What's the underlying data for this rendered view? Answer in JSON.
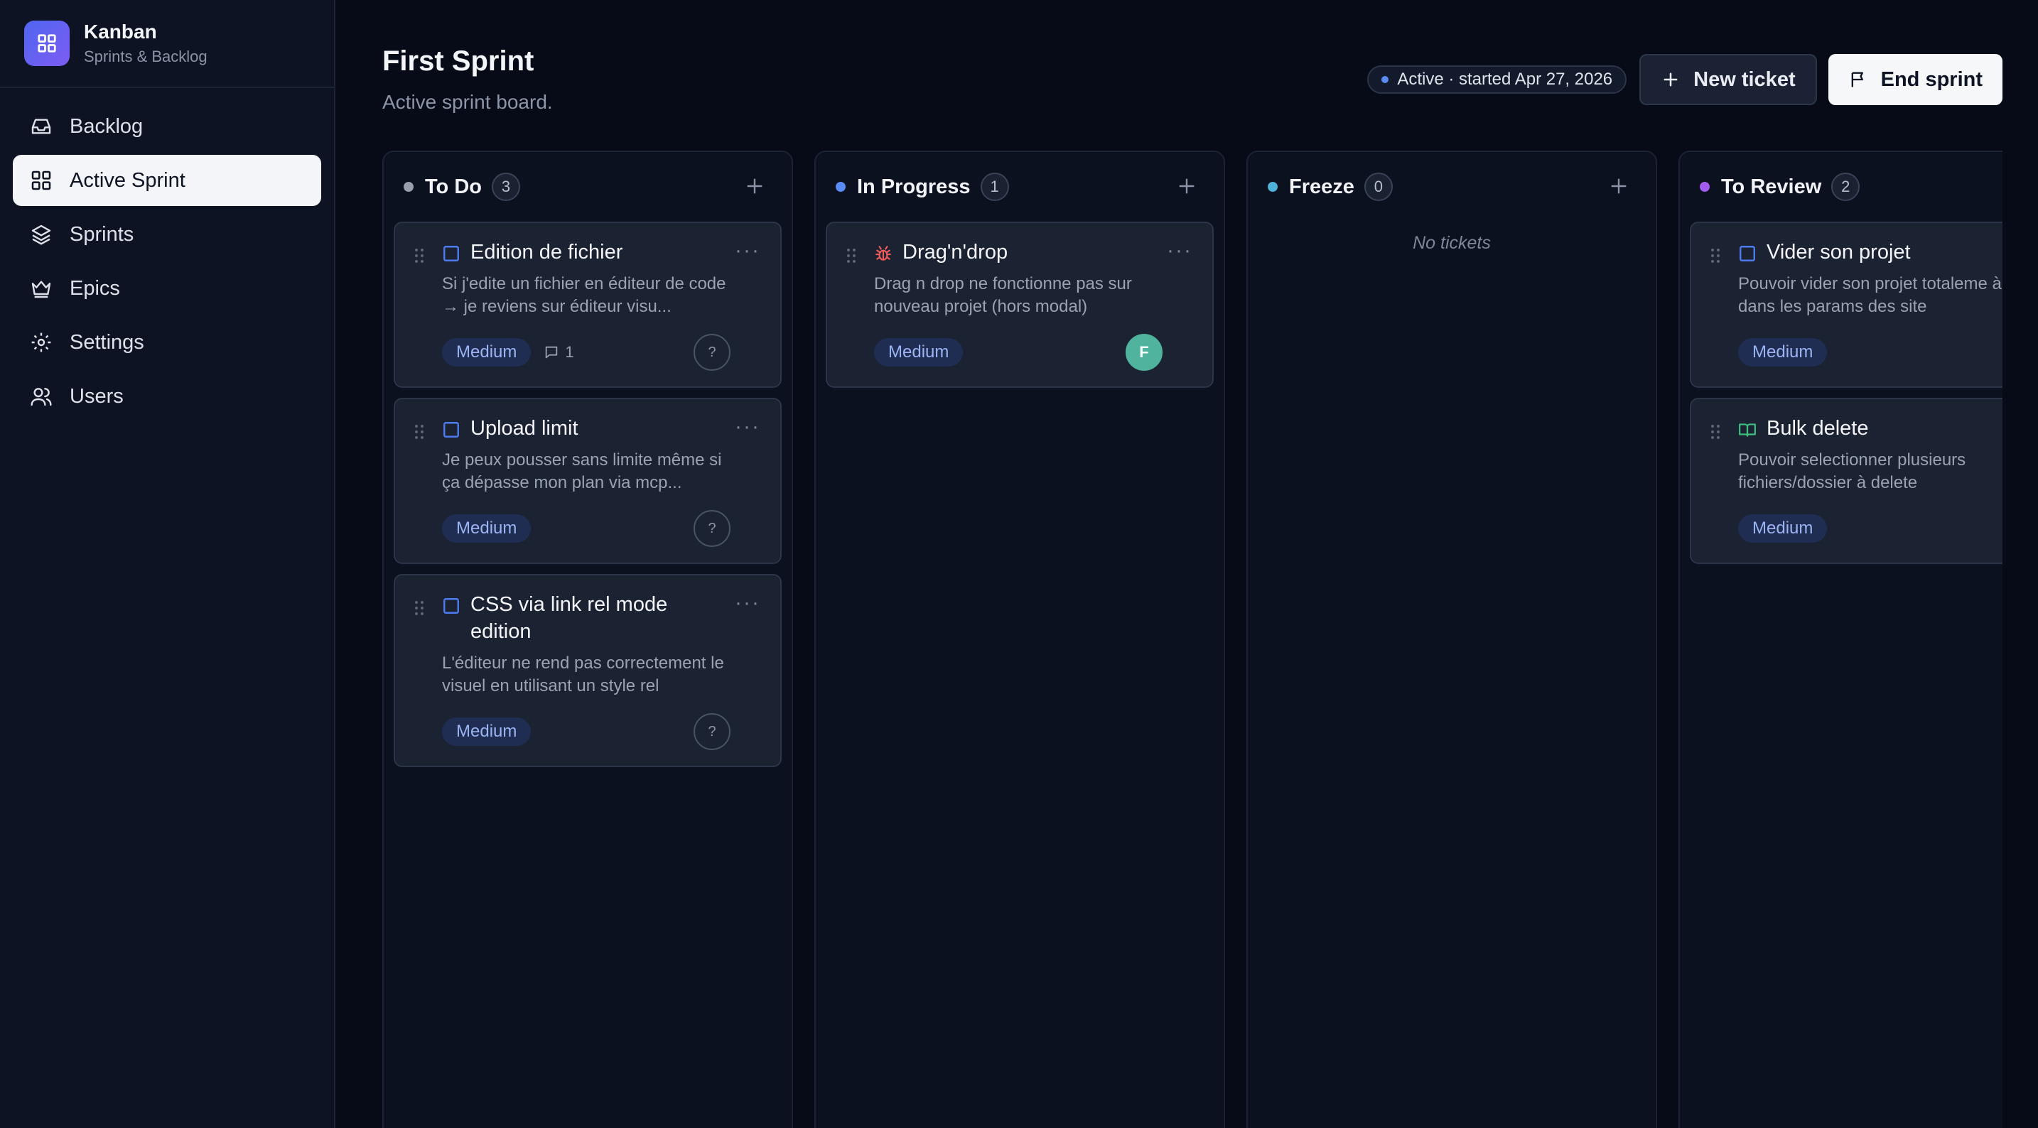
{
  "app": {
    "title": "Kanban",
    "subtitle": "Sprints & Backlog"
  },
  "sidebar": {
    "items": [
      {
        "label": "Backlog",
        "icon": "inbox-icon"
      },
      {
        "label": "Active Sprint",
        "icon": "grid-icon",
        "active": true
      },
      {
        "label": "Sprints",
        "icon": "layers-icon"
      },
      {
        "label": "Epics",
        "icon": "crown-icon"
      },
      {
        "label": "Settings",
        "icon": "gear-icon"
      },
      {
        "label": "Users",
        "icon": "users-icon"
      }
    ]
  },
  "header": {
    "title": "First Sprint",
    "subtitle": "Active sprint board.",
    "status": "Active · started Apr 27, 2026",
    "new_ticket_label": "New ticket",
    "end_sprint_label": "End sprint"
  },
  "columns": [
    {
      "title": "To Do",
      "count": "3",
      "dot_color": "#9aa0ab",
      "cards": [
        {
          "title": "Edition de fichier",
          "desc": "Si j'edite un fichier en éditeur de code → je reviens sur éditeur visu...",
          "priority": "Medium",
          "comments": "1",
          "assignee": "?",
          "type": "task"
        },
        {
          "title": "Upload limit",
          "desc": "Je peux pousser sans limite même si ça dépasse mon plan via mcp...",
          "priority": "Medium",
          "assignee": "?",
          "type": "task"
        },
        {
          "title": "CSS via link rel mode edition",
          "desc": "L'éditeur ne rend pas correctement le visuel en utilisant un style rel",
          "priority": "Medium",
          "assignee": "?",
          "type": "task"
        }
      ]
    },
    {
      "title": "In Progress",
      "count": "1",
      "dot_color": "#5b8cf5",
      "cards": [
        {
          "title": "Drag'n'drop",
          "desc": "Drag n drop ne fonctionne pas sur nouveau projet (hors modal)",
          "priority": "Medium",
          "assignee": "F",
          "type": "bug"
        }
      ]
    },
    {
      "title": "Freeze",
      "count": "0",
      "dot_color": "#4fb0d8",
      "empty_text": "No tickets",
      "cards": []
    },
    {
      "title": "To Review",
      "count": "2",
      "dot_color": "#a35cf0",
      "cards": [
        {
          "title": "Vider son projet",
          "desc": "Pouvoir vider son projet totaleme à mettre dans les params des site",
          "priority": "Medium",
          "assignee": "",
          "type": "task"
        },
        {
          "title": "Bulk delete",
          "desc": "Pouvoir selectionner plusieurs fichiers/dossier à delete",
          "priority": "Medium",
          "assignee": "",
          "type": "story"
        }
      ]
    }
  ],
  "colors": {
    "accent": "#5b6ef3",
    "priority_bg": "#1f2d52",
    "priority_text": "#9cb5f2",
    "avatar": "#4fb39d"
  }
}
